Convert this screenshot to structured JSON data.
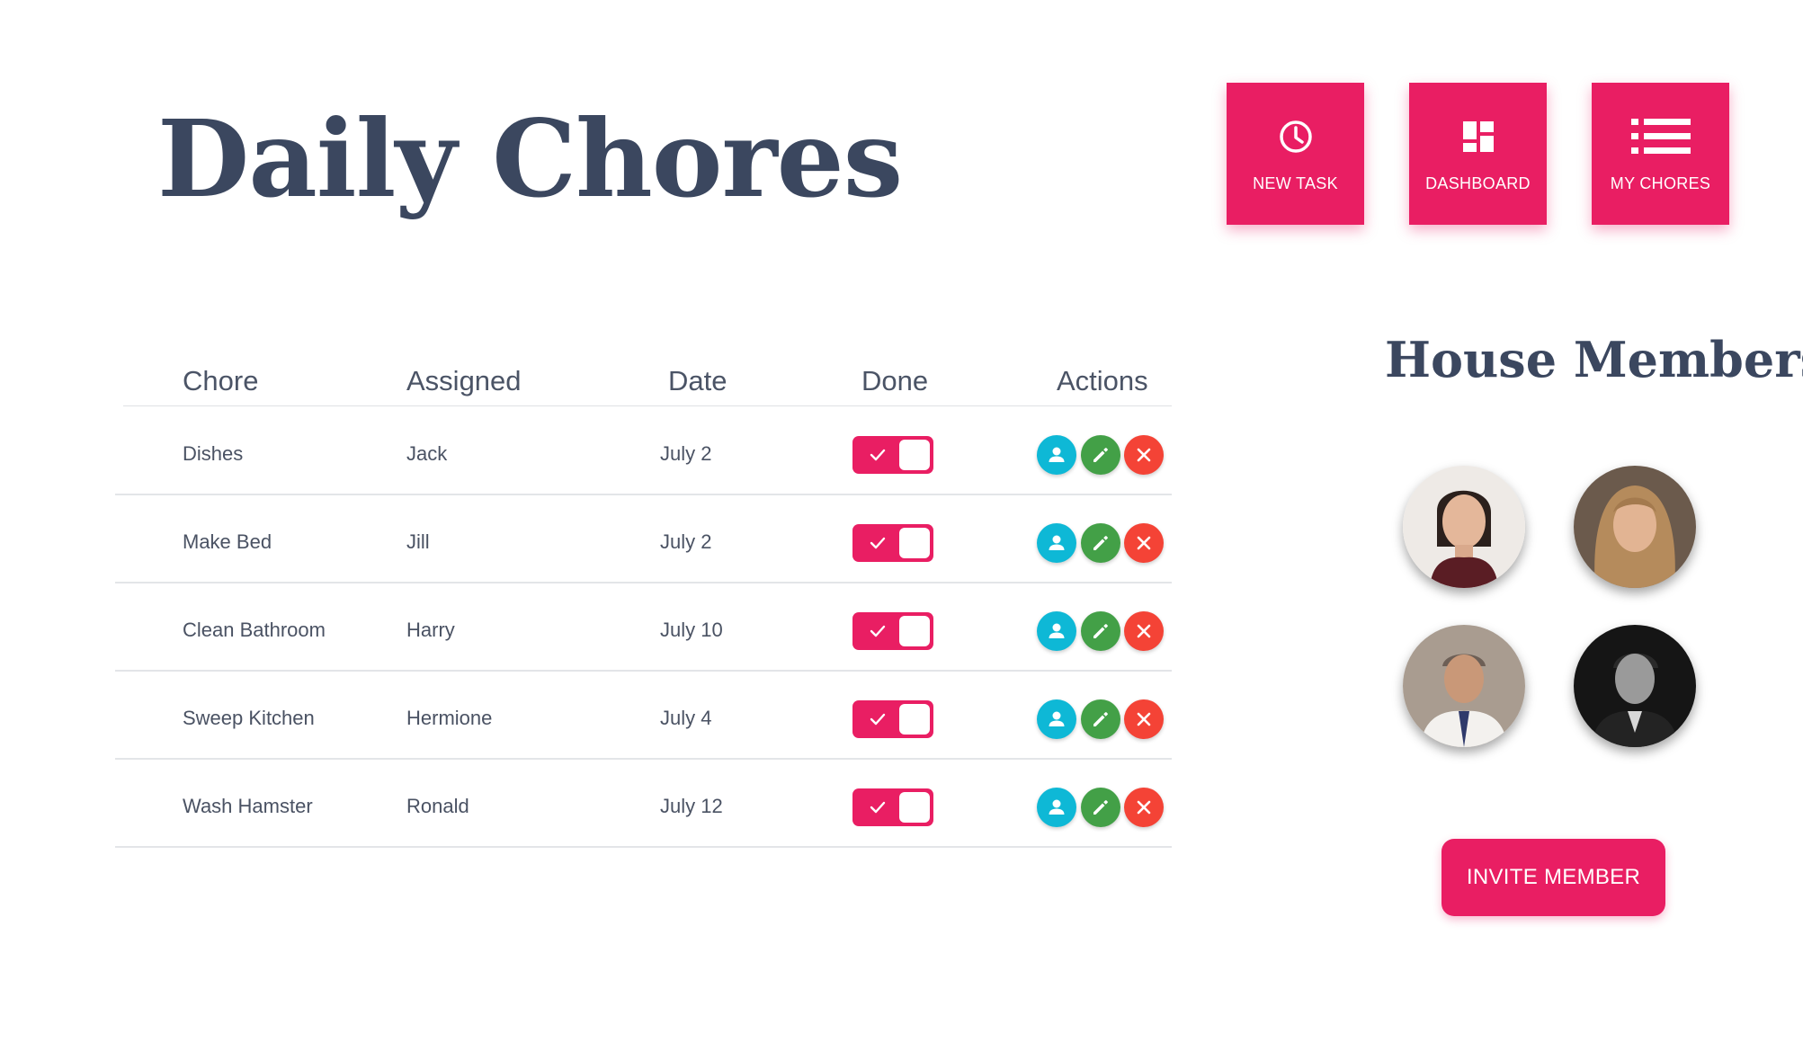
{
  "page": {
    "title": "Daily Chores"
  },
  "nav": [
    {
      "label": "NEW TASK",
      "icon": "clock-icon"
    },
    {
      "label": "DASHBOARD",
      "icon": "dashboard-icon"
    },
    {
      "label": "MY CHORES",
      "icon": "list-icon"
    }
  ],
  "table": {
    "headers": {
      "chore": "Chore",
      "assigned": "Assigned",
      "date": "Date",
      "done": "Done",
      "actions": "Actions"
    },
    "rows": [
      {
        "chore": "Dishes",
        "assigned": "Jack",
        "date": "July 2",
        "done": true
      },
      {
        "chore": "Make Bed",
        "assigned": "Jill",
        "date": "July 2",
        "done": true
      },
      {
        "chore": "Clean Bathroom",
        "assigned": "Harry",
        "date": "July 10",
        "done": true
      },
      {
        "chore": "Sweep Kitchen",
        "assigned": "Hermione",
        "date": "July 4",
        "done": true
      },
      {
        "chore": "Wash Hamster",
        "assigned": "Ronald",
        "date": "July 12",
        "done": true
      }
    ],
    "actions": [
      "user-icon",
      "pencil-icon",
      "close-icon"
    ]
  },
  "members": {
    "title": "House Members",
    "avatars": [
      "avatar-1",
      "avatar-2",
      "avatar-3",
      "avatar-4"
    ]
  },
  "invite": {
    "label": "INVITE MEMBER"
  },
  "colors": {
    "accent": "#e91e63",
    "heading": "#3b475f",
    "action_user": "#0eb8d6",
    "action_edit": "#43a047",
    "action_delete": "#f44336"
  }
}
